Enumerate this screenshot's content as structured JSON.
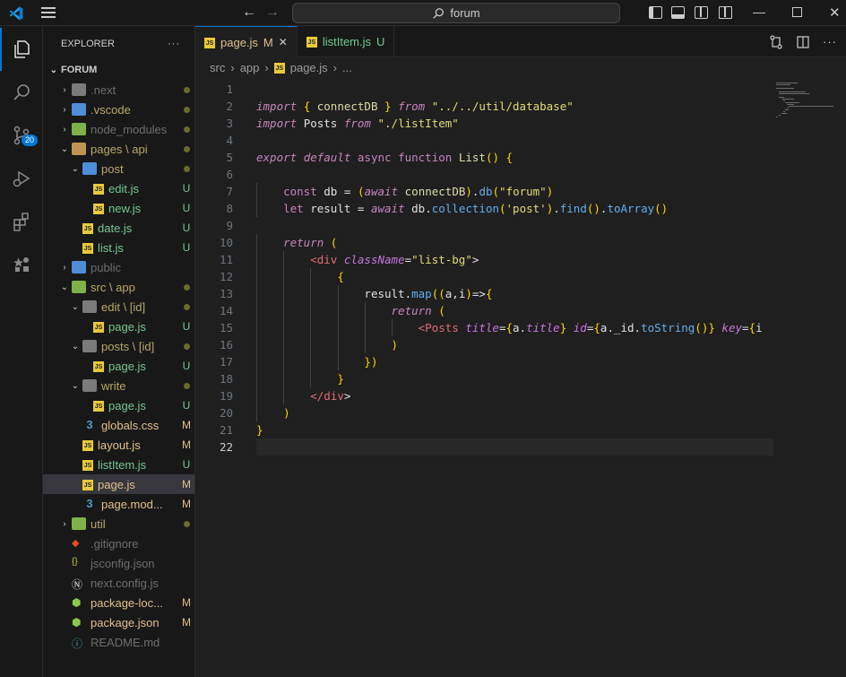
{
  "titlebar": {
    "search_text": "forum",
    "back_icon": "arrow-left-icon",
    "forward_icon": "arrow-right-icon"
  },
  "activitybar": {
    "scm_badge": "20"
  },
  "sidebar": {
    "title": "EXPLORER",
    "more": "···",
    "root": "FORUM",
    "items": [
      {
        "label": ".next",
        "status": "dot",
        "depth": 1,
        "type": "folder",
        "open": false,
        "cls": "c-ign",
        "icon": "gray"
      },
      {
        "label": ".vscode",
        "status": "dot",
        "depth": 1,
        "type": "folder",
        "open": false,
        "cls": "c-dir",
        "icon": "blue"
      },
      {
        "label": "node_modules",
        "status": "dot",
        "depth": 1,
        "type": "folder",
        "open": false,
        "cls": "c-ign",
        "icon": "green"
      },
      {
        "label": "pages \\ api",
        "status": "dot",
        "depth": 1,
        "type": "folder",
        "open": true,
        "cls": "c-dir",
        "icon": "orange"
      },
      {
        "label": "post",
        "status": "dot",
        "depth": 2,
        "type": "folder",
        "open": true,
        "cls": "c-dir",
        "icon": "blue"
      },
      {
        "label": "edit.js",
        "status": "U",
        "depth": 3,
        "type": "js",
        "cls": "c-un"
      },
      {
        "label": "new.js",
        "status": "U",
        "depth": 3,
        "type": "js",
        "cls": "c-un"
      },
      {
        "label": "date.js",
        "status": "U",
        "depth": 2,
        "type": "js",
        "cls": "c-un"
      },
      {
        "label": "list.js",
        "status": "U",
        "depth": 2,
        "type": "js",
        "cls": "c-un"
      },
      {
        "label": "public",
        "status": "",
        "depth": 1,
        "type": "folder",
        "open": false,
        "cls": "c-ign",
        "icon": "blue"
      },
      {
        "label": "src \\ app",
        "status": "dot",
        "depth": 1,
        "type": "folder",
        "open": true,
        "cls": "c-dir",
        "icon": "green"
      },
      {
        "label": "edit \\ [id]",
        "status": "dot",
        "depth": 2,
        "type": "folder",
        "open": true,
        "cls": "c-dir",
        "icon": "gray"
      },
      {
        "label": "page.js",
        "status": "U",
        "depth": 3,
        "type": "js",
        "cls": "c-un"
      },
      {
        "label": "posts \\ [id]",
        "status": "dot",
        "depth": 2,
        "type": "folder",
        "open": true,
        "cls": "c-dir",
        "icon": "gray"
      },
      {
        "label": "page.js",
        "status": "U",
        "depth": 3,
        "type": "js",
        "cls": "c-un"
      },
      {
        "label": "write",
        "status": "dot",
        "depth": 2,
        "type": "folder",
        "open": true,
        "cls": "c-dir",
        "icon": "gray"
      },
      {
        "label": "page.js",
        "status": "U",
        "depth": 3,
        "type": "js",
        "cls": "c-un"
      },
      {
        "label": "globals.css",
        "status": "M",
        "depth": 2,
        "type": "css",
        "cls": "c-mod"
      },
      {
        "label": "layout.js",
        "status": "M",
        "depth": 2,
        "type": "js",
        "cls": "c-mod"
      },
      {
        "label": "listItem.js",
        "status": "U",
        "depth": 2,
        "type": "js",
        "cls": "c-un"
      },
      {
        "label": "page.js",
        "status": "M",
        "depth": 2,
        "type": "js",
        "cls": "c-mod",
        "selected": true
      },
      {
        "label": "page.mod...",
        "status": "M",
        "depth": 2,
        "type": "css",
        "cls": "c-mod"
      },
      {
        "label": "util",
        "status": "dot",
        "depth": 1,
        "type": "folder",
        "open": false,
        "cls": "c-dir",
        "icon": "green"
      },
      {
        "label": ".gitignore",
        "status": "",
        "depth": 1,
        "type": "git",
        "cls": "c-ign"
      },
      {
        "label": "jsconfig.json",
        "status": "",
        "depth": 1,
        "type": "json",
        "cls": "c-ign"
      },
      {
        "label": "next.config.js",
        "status": "",
        "depth": 1,
        "type": "next",
        "cls": "c-ign"
      },
      {
        "label": "package-loc...",
        "status": "M",
        "depth": 1,
        "type": "node",
        "cls": "c-mod"
      },
      {
        "label": "package.json",
        "status": "M",
        "depth": 1,
        "type": "node",
        "cls": "c-mod"
      },
      {
        "label": "README.md",
        "status": "",
        "depth": 1,
        "type": "info",
        "cls": "c-ign"
      }
    ]
  },
  "tabs": [
    {
      "label": "page.js",
      "status": "M",
      "close": "✕",
      "active": true
    },
    {
      "label": "listItem.js",
      "status": "U",
      "close": "",
      "active": false
    }
  ],
  "breadcrumb": {
    "parts": [
      "src",
      "app",
      "page.js",
      "..."
    ]
  },
  "editor": {
    "current_line": 22,
    "lines": [
      "",
      "import { connectDB } from \"../../util/database\"",
      "import Posts from \"./listItem\"",
      "",
      "export default async function List() {",
      "",
      "    const db = (await connectDB).db(\"forum\")",
      "    let result = await db.collection('post').find().toArray()",
      "",
      "    return (",
      "        <div className=\"list-bg\">",
      "            {",
      "                result.map((a,i)=>{",
      "                    return (",
      "                        <Posts title={a.title} id={a._id.toString()} key={i",
      "                    )",
      "                })",
      "            }",
      "        </div>",
      "    )",
      "}",
      ""
    ]
  },
  "colors": {
    "accent": "#0078d4",
    "modified": "#e2c08d",
    "untracked": "#73c991"
  }
}
